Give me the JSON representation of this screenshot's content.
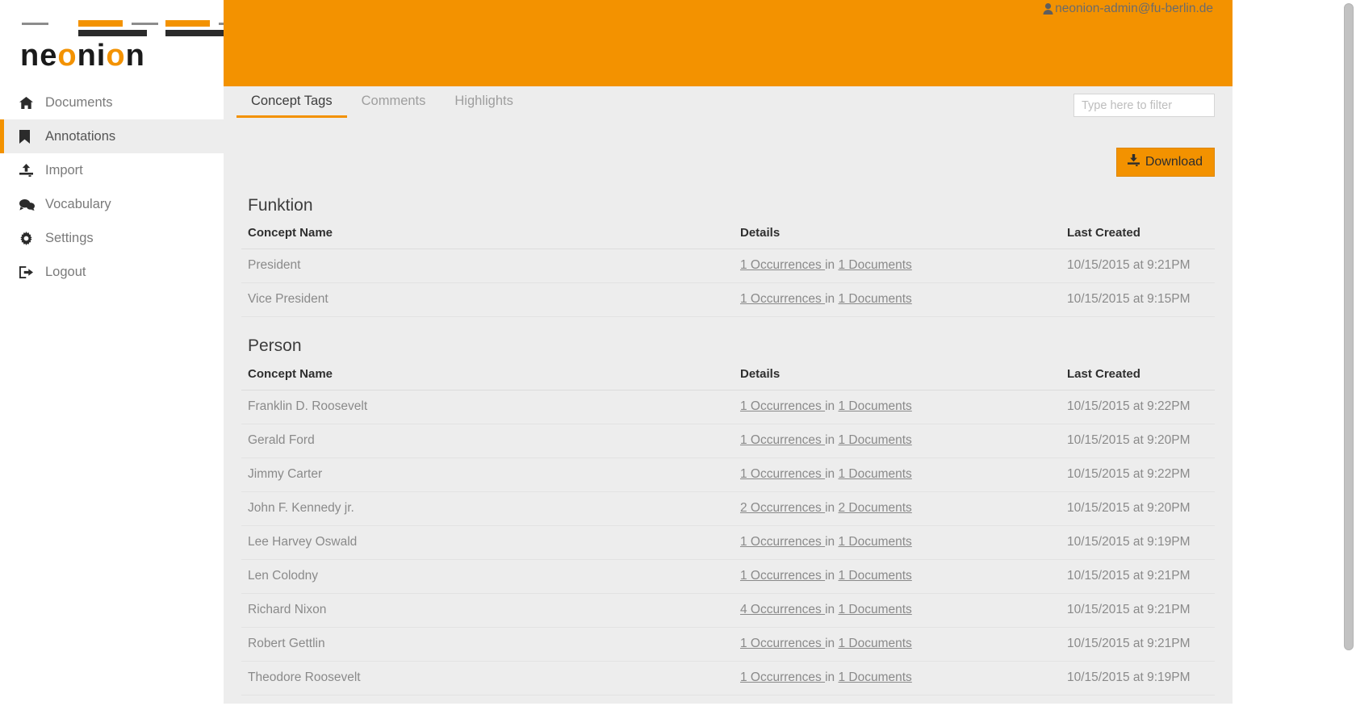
{
  "brand": {
    "word_before": "ne",
    "word_o1": "o",
    "word_mid": "ni",
    "word_o2": "o",
    "word_after": "n",
    "accent_color": "#f39200",
    "dark_color": "#1a1a1a"
  },
  "header": {
    "user_email": "neonion-admin@fu-berlin.de",
    "user_icon": "user-icon",
    "background_color": "#f39200"
  },
  "sidebar": {
    "items": [
      {
        "label": "Documents",
        "icon": "home-icon",
        "active": false
      },
      {
        "label": "Annotations",
        "icon": "bookmark-icon",
        "active": true
      },
      {
        "label": "Import",
        "icon": "upload-icon",
        "active": false
      },
      {
        "label": "Vocabulary",
        "icon": "comments-icon",
        "active": false
      },
      {
        "label": "Settings",
        "icon": "gear-icon",
        "active": false
      },
      {
        "label": "Logout",
        "icon": "sign-out-icon",
        "active": false
      }
    ]
  },
  "tabs": [
    {
      "label": "Concept Tags",
      "active": true
    },
    {
      "label": "Comments",
      "active": false
    },
    {
      "label": "Highlights",
      "active": false
    }
  ],
  "filter": {
    "placeholder": "Type here to filter",
    "value": ""
  },
  "toolbar": {
    "download_label": "Download",
    "download_icon": "download-icon"
  },
  "columns": {
    "name": "Concept Name",
    "details": "Details",
    "created": "Last Created"
  },
  "details_connector": " in ",
  "groups": [
    {
      "title": "Funktion",
      "rows": [
        {
          "name": "President",
          "occurrences": "1 Occurrences ",
          "documents": "1 Documents",
          "created": "10/15/2015 at 9:21PM"
        },
        {
          "name": "Vice President",
          "occurrences": "1 Occurrences ",
          "documents": "1 Documents",
          "created": "10/15/2015 at 9:15PM"
        }
      ]
    },
    {
      "title": "Person",
      "rows": [
        {
          "name": "Franklin D. Roosevelt",
          "occurrences": "1 Occurrences ",
          "documents": "1 Documents",
          "created": "10/15/2015 at 9:22PM"
        },
        {
          "name": "Gerald Ford",
          "occurrences": "1 Occurrences ",
          "documents": "1 Documents",
          "created": "10/15/2015 at 9:20PM"
        },
        {
          "name": "Jimmy Carter",
          "occurrences": "1 Occurrences ",
          "documents": "1 Documents",
          "created": "10/15/2015 at 9:22PM"
        },
        {
          "name": "John F. Kennedy jr.",
          "occurrences": "2 Occurrences ",
          "documents": "2 Documents",
          "created": "10/15/2015 at 9:20PM"
        },
        {
          "name": "Lee Harvey Oswald",
          "occurrences": "1 Occurrences ",
          "documents": "1 Documents",
          "created": "10/15/2015 at 9:19PM"
        },
        {
          "name": "Len Colodny",
          "occurrences": "1 Occurrences ",
          "documents": "1 Documents",
          "created": "10/15/2015 at 9:21PM"
        },
        {
          "name": "Richard Nixon",
          "occurrences": "4 Occurrences ",
          "documents": "1 Documents",
          "created": "10/15/2015 at 9:21PM"
        },
        {
          "name": "Robert Gettlin",
          "occurrences": "1 Occurrences ",
          "documents": "1 Documents",
          "created": "10/15/2015 at 9:21PM"
        },
        {
          "name": "Theodore Roosevelt",
          "occurrences": "1 Occurrences ",
          "documents": "1 Documents",
          "created": "10/15/2015 at 9:19PM"
        }
      ]
    }
  ]
}
